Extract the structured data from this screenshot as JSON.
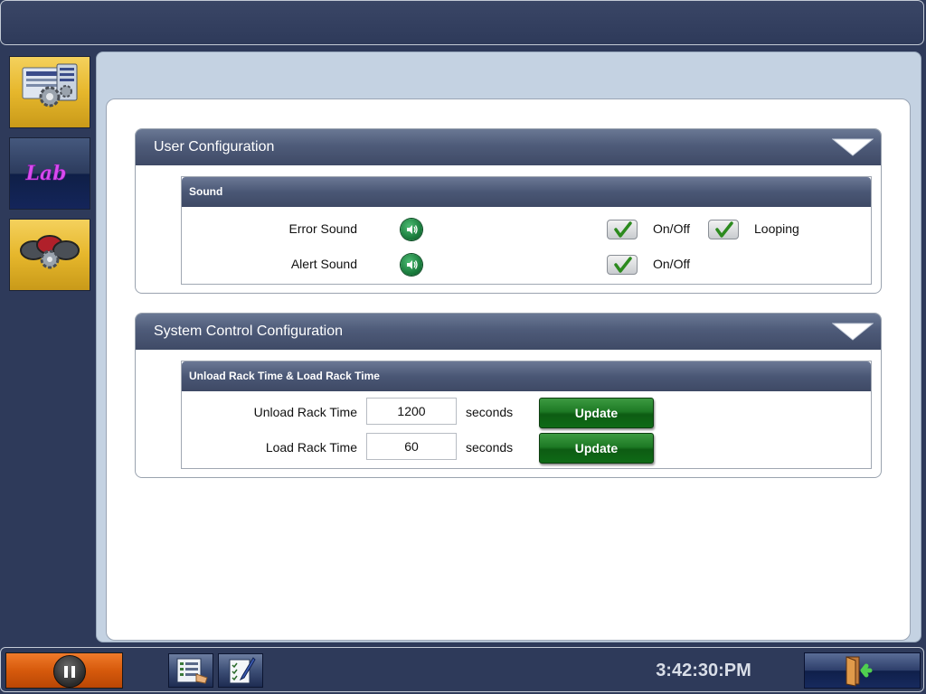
{
  "sidebar": {
    "items": [
      {
        "name": "system-settings",
        "icon": "server-gear-icon"
      },
      {
        "name": "lab",
        "icon": "lab-icon",
        "label": "Lab"
      },
      {
        "name": "device-settings",
        "icon": "color-gear-icon"
      }
    ]
  },
  "user_config": {
    "title": "User Configuration",
    "sound": {
      "title": "Sound",
      "rows": [
        {
          "label": "Error Sound",
          "on_off_label": "On/Off",
          "on_off": true,
          "looping_label": "Looping",
          "looping": true
        },
        {
          "label": "Alert Sound",
          "on_off_label": "On/Off",
          "on_off": true
        }
      ]
    }
  },
  "system_config": {
    "title": "System Control Configuration",
    "rack": {
      "title": "Unload Rack Time & Load Rack Time",
      "rows": [
        {
          "label": "Unload Rack Time",
          "value": "1200",
          "unit": "seconds",
          "button": "Update"
        },
        {
          "label": "Load Rack Time",
          "value": "60",
          "unit": "seconds",
          "button": "Update"
        }
      ]
    }
  },
  "bottombar": {
    "clock": "3:42:30:PM"
  },
  "colors": {
    "background": "#2e3a5a",
    "header": "#4e5b79",
    "accent_green": "#1e7a25",
    "pause_orange": "#d65a0c",
    "sidebar_gold": "#e6b72c"
  }
}
